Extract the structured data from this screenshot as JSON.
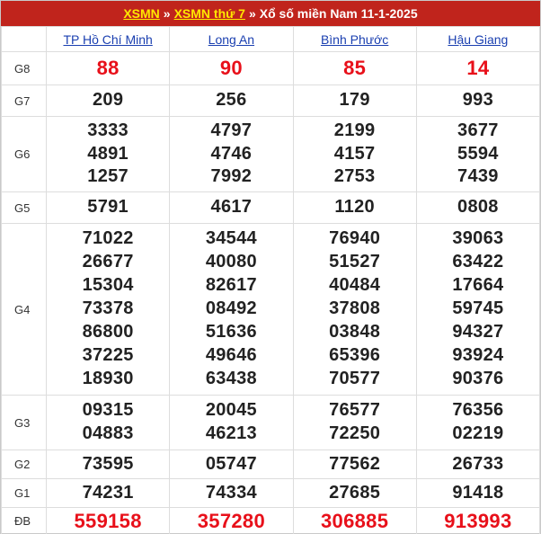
{
  "header": {
    "link1": "XSMN",
    "sep1": "»",
    "link2": "XSMN thứ 7",
    "sep2": "»",
    "title": "Xổ số miền Nam 11-1-2025"
  },
  "provinces": [
    "TP Hồ Chí Minh",
    "Long An",
    "Bình Phước",
    "Hậu Giang"
  ],
  "prizes": [
    {
      "label": "G8",
      "cls": "g8",
      "h": 37,
      "values": [
        [
          "88"
        ],
        [
          "90"
        ],
        [
          "85"
        ],
        [
          "14"
        ]
      ]
    },
    {
      "label": "G7",
      "cls": "g7",
      "h": 35,
      "values": [
        [
          "209"
        ],
        [
          "256"
        ],
        [
          "179"
        ],
        [
          "993"
        ]
      ]
    },
    {
      "label": "G6",
      "cls": "g6",
      "h": 84,
      "values": [
        [
          "3333",
          "4891",
          "1257"
        ],
        [
          "4797",
          "4746",
          "7992"
        ],
        [
          "2199",
          "4157",
          "2753"
        ],
        [
          "3677",
          "5594",
          "7439"
        ]
      ]
    },
    {
      "label": "G5",
      "cls": "g5",
      "h": 35,
      "values": [
        [
          "5791"
        ],
        [
          "4617"
        ],
        [
          "1120"
        ],
        [
          "0808"
        ]
      ]
    },
    {
      "label": "G4",
      "cls": "g4",
      "h": 191,
      "values": [
        [
          "71022",
          "26677",
          "15304",
          "73378",
          "86800",
          "37225",
          "18930"
        ],
        [
          "34544",
          "40080",
          "82617",
          "08492",
          "51636",
          "49646",
          "63438"
        ],
        [
          "76940",
          "51527",
          "40484",
          "37808",
          "03848",
          "65396",
          "70577"
        ],
        [
          "39063",
          "63422",
          "17664",
          "59745",
          "94327",
          "93924",
          "90376"
        ]
      ]
    },
    {
      "label": "G3",
      "cls": "g3",
      "h": 61,
      "values": [
        [
          "09315",
          "04883"
        ],
        [
          "20045",
          "46213"
        ],
        [
          "76577",
          "72250"
        ],
        [
          "76356",
          "02219"
        ]
      ]
    },
    {
      "label": "G2",
      "cls": "g2",
      "h": 32,
      "values": [
        [
          "73595"
        ],
        [
          "05747"
        ],
        [
          "77562"
        ],
        [
          "26733"
        ]
      ]
    },
    {
      "label": "G1",
      "cls": "g1",
      "h": 32,
      "values": [
        [
          "74231"
        ],
        [
          "74334"
        ],
        [
          "27685"
        ],
        [
          "91418"
        ]
      ]
    },
    {
      "label": "ĐB",
      "cls": "db",
      "h": 30,
      "values": [
        [
          "559158"
        ],
        [
          "357280"
        ],
        [
          "306885"
        ],
        [
          "913993"
        ]
      ]
    }
  ]
}
